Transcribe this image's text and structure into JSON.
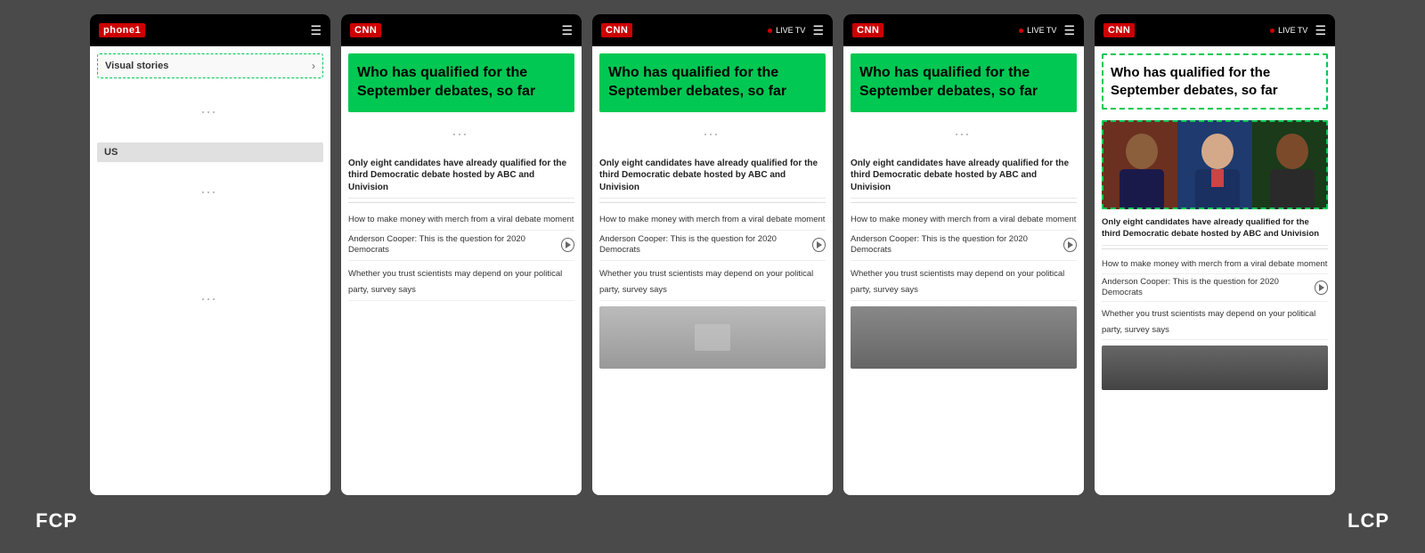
{
  "bg_color": "#4a4a4a",
  "labels": {
    "fcp": "FCP",
    "lcp": "LCP"
  },
  "phones": [
    {
      "id": "phone1",
      "has_live_tv": false,
      "content_type": "visual_stories",
      "visual_stories_label": "Visual stories",
      "us_label": "US"
    },
    {
      "id": "phone2",
      "has_live_tv": false,
      "content_type": "article_no_image",
      "headline": "Who has qualified for the September debates, so far",
      "main_article": "Only eight candidates have already qualified for the third Democratic debate hosted by ABC and Univision",
      "articles": [
        {
          "text": "How to make money with merch from a viral debate moment",
          "has_play": false
        },
        {
          "text": "Anderson Cooper: This is the question for 2020 Democrats",
          "has_play": true
        },
        {
          "text": "Whether you trust scientists may depend on your political party, survey says",
          "has_play": false
        }
      ]
    },
    {
      "id": "phone3",
      "has_live_tv": true,
      "content_type": "article_partial_image",
      "headline": "Who has qualified for the September debates, so far",
      "main_article": "Only eight candidates have already qualified for the third Democratic debate hosted by ABC and Univision",
      "articles": [
        {
          "text": "How to make money with merch from a viral debate moment",
          "has_play": false
        },
        {
          "text": "Anderson Cooper: This is the question for 2020 Democrats",
          "has_play": true
        },
        {
          "text": "Whether you trust scientists may depend on your political party, survey says",
          "has_play": false
        }
      ]
    },
    {
      "id": "phone4",
      "has_live_tv": true,
      "content_type": "article_partial_image",
      "headline": "Who has qualified for the September debates, so far",
      "main_article": "Only eight candidates have already qualified for the third Democratic debate hosted by ABC and Univision",
      "articles": [
        {
          "text": "How to make money with merch from a viral debate moment",
          "has_play": false
        },
        {
          "text": "Anderson Cooper: This is the question for 2020 Democrats",
          "has_play": true
        },
        {
          "text": "Whether you trust scientists may depend on your political party, survey says",
          "has_play": false
        }
      ]
    },
    {
      "id": "phone5",
      "has_live_tv": true,
      "content_type": "article_full_image",
      "headline": "Who has qualified for the September debates, so far",
      "main_article": "Only eight candidates have already qualified for the third Democratic debate hosted by ABC and Univision",
      "articles": [
        {
          "text": "How to make money with merch from a viral debate moment",
          "has_play": false
        },
        {
          "text": "Anderson Cooper: This is the question for 2020 Democrats",
          "has_play": true
        },
        {
          "text": "Whether you trust scientists may depend on your political party, survey says",
          "has_play": false
        }
      ]
    }
  ]
}
